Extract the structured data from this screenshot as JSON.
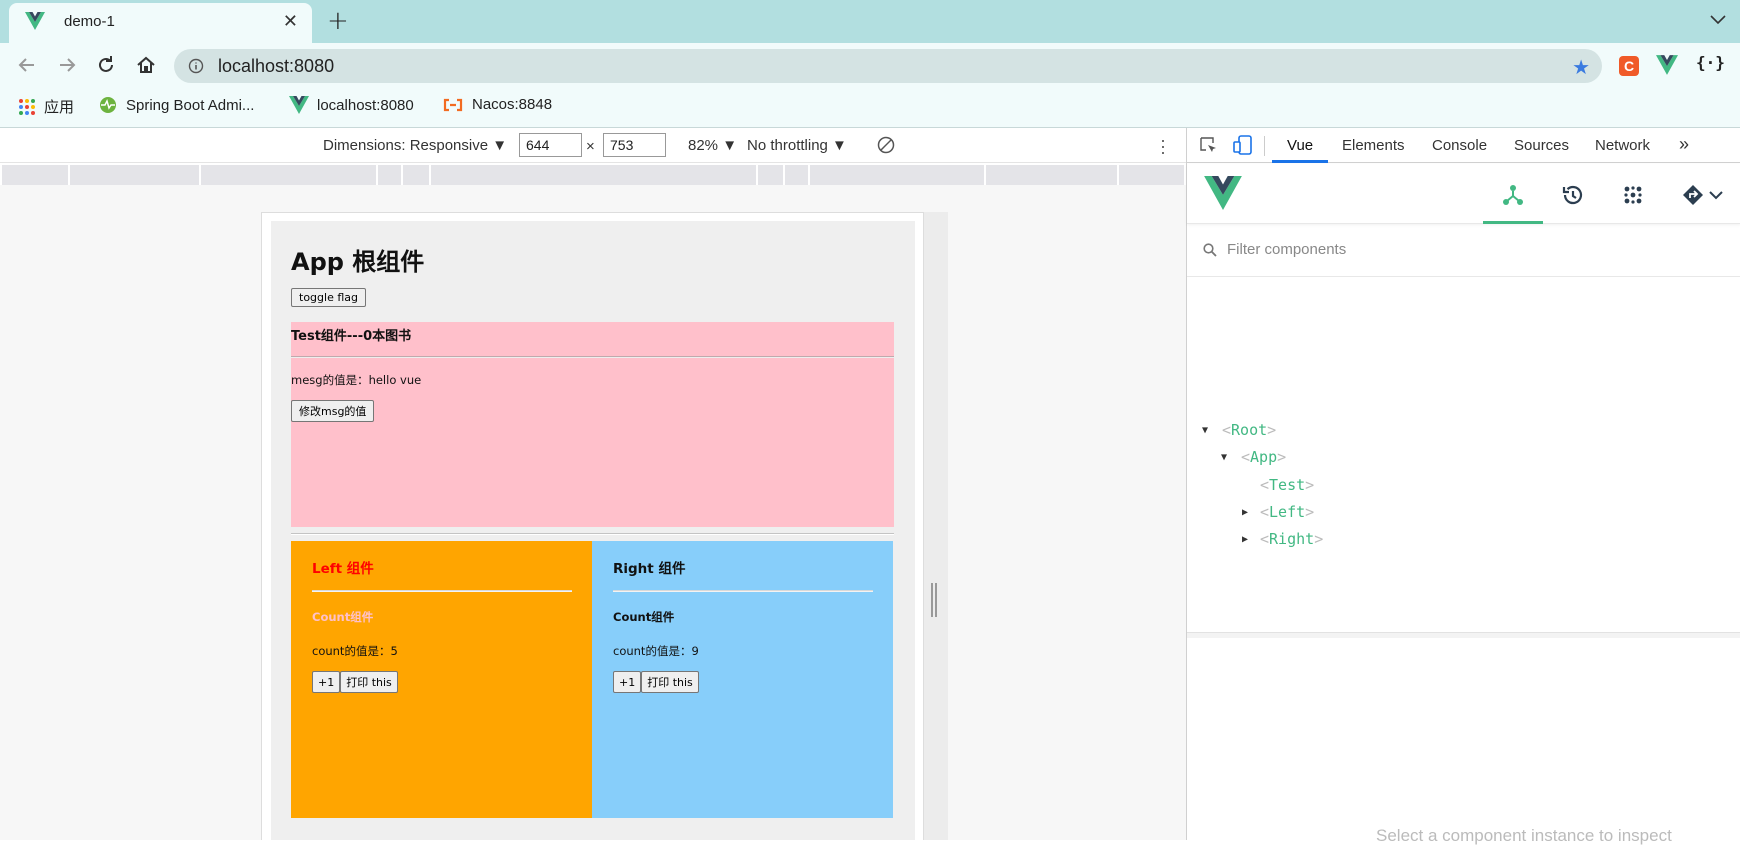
{
  "browser": {
    "tab_title": "demo-1",
    "url": "localhost:8080",
    "bookmarks": [
      {
        "label": "应用"
      },
      {
        "label": "Spring Boot Admi..."
      },
      {
        "label": "localhost:8080"
      },
      {
        "label": "Nacos:8848"
      }
    ]
  },
  "device_toolbar": {
    "dimensions_label": "Dimensions: Responsive ▼",
    "width": "644",
    "times": "×",
    "height": "753",
    "zoom": "82% ▼",
    "throttling": "No throttling ▼"
  },
  "app": {
    "title": "App 根组件",
    "toggle_label": "toggle flag",
    "test": {
      "title": "Test组件---0本图书",
      "msg": "mesg的值是：hello vue",
      "button": "修改msg的值"
    },
    "left": {
      "title": "Left 组件",
      "count_title": "Count组件",
      "count_text": "count的值是：5",
      "inc": "+1",
      "print": "打印 this"
    },
    "right": {
      "title": "Right 组件",
      "count_title": "Count组件",
      "count_text": "count的值是：9",
      "inc": "+1",
      "print": "打印 this"
    }
  },
  "devtools": {
    "tabs": [
      "Vue",
      "Elements",
      "Console",
      "Sources",
      "Network"
    ],
    "more": "»",
    "filter_placeholder": "Filter components",
    "tree": [
      {
        "name": "Root"
      },
      {
        "name": "App"
      },
      {
        "name": "Test"
      },
      {
        "name": "Left"
      },
      {
        "name": "Right"
      }
    ],
    "hint": "Select a component instance to inspect"
  },
  "colors": {
    "vue_green": "#42b883",
    "test_bg": "#ffc0cb",
    "left_bg": "#ffa500",
    "right_bg": "#87cefa"
  }
}
